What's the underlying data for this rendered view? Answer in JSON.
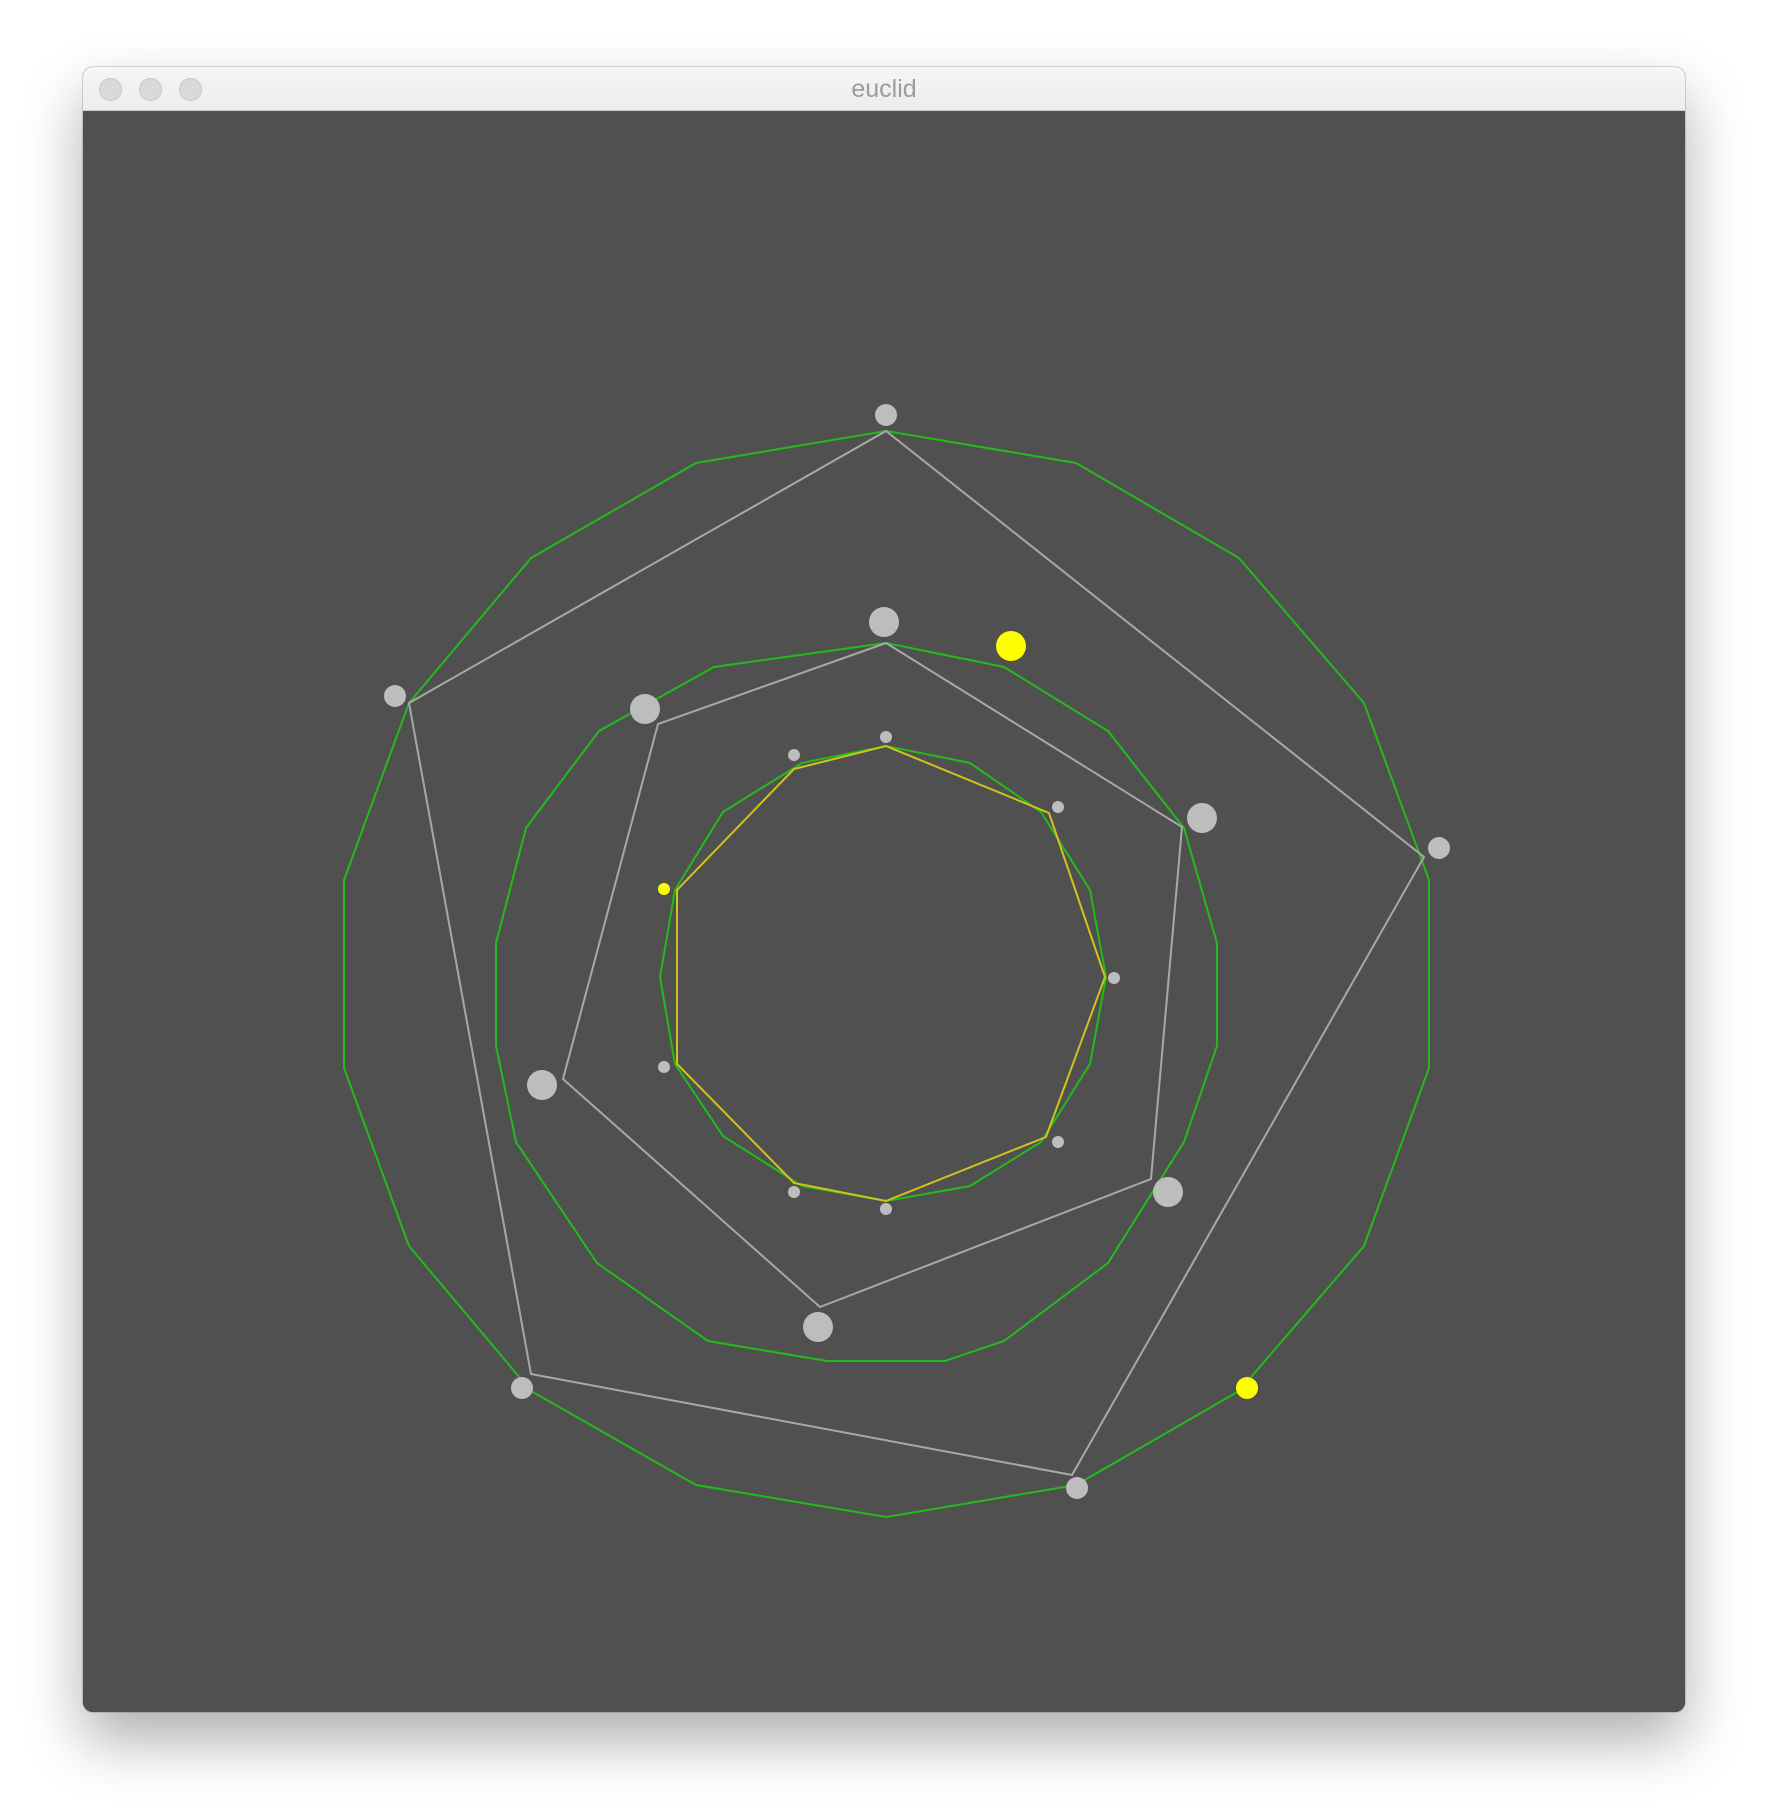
{
  "window": {
    "title": "euclid"
  },
  "controls": {
    "close_icon": "close-icon",
    "minimize_icon": "minimize-icon",
    "zoom_icon": "zoom-icon"
  },
  "colors": {
    "background": "#505050",
    "circle_polygon": "#22bb1a",
    "construction": "#a8a8a8",
    "highlight": "#d2c21e",
    "point": "#bdbdbd",
    "active_point": "#ffff00"
  },
  "figures": {
    "outer": {
      "circle_sides": 17,
      "inscribed_sides": 5
    },
    "middle": {
      "circle_sides": 15,
      "inscribed_sides": 7
    },
    "inner": {
      "circle_sides": 13,
      "inscribed_sides": 9
    }
  }
}
